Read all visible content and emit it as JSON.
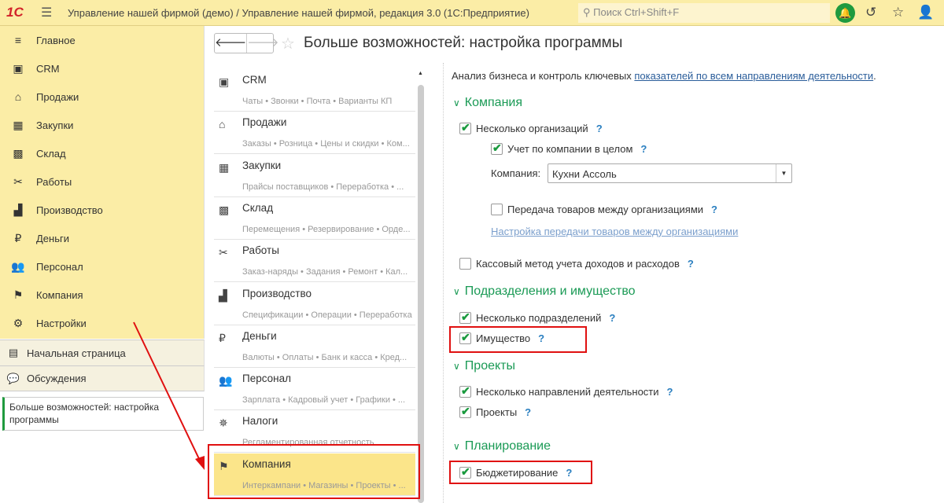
{
  "topbar": {
    "logo": "1С",
    "title": "Управление нашей фирмой (демо) / Управление нашей фирмой, редакция 3.0  (1С:Предприятие)",
    "search_placeholder": "Поиск Ctrl+Shift+F"
  },
  "sidebar": {
    "items": [
      {
        "label": "Главное",
        "icon": "≡"
      },
      {
        "label": "CRM",
        "icon": "▣"
      },
      {
        "label": "Продажи",
        "icon": "⌂"
      },
      {
        "label": "Закупки",
        "icon": "▦"
      },
      {
        "label": "Склад",
        "icon": "▩"
      },
      {
        "label": "Работы",
        "icon": "✂"
      },
      {
        "label": "Производство",
        "icon": "▟"
      },
      {
        "label": "Деньги",
        "icon": "₽"
      },
      {
        "label": "Персонал",
        "icon": "👥"
      },
      {
        "label": "Компания",
        "icon": "⚑"
      },
      {
        "label": "Настройки",
        "icon": "⚙"
      }
    ],
    "home": "Начальная страница",
    "discussions": "Обсуждения",
    "open_window": "Больше возможностей: настройка программы"
  },
  "page": {
    "title": "Больше возможностей: настройка программы"
  },
  "sections": [
    {
      "title": "CRM",
      "sub": "Чаты • Звонки • Почта • Варианты КП",
      "icon": "▣"
    },
    {
      "title": "Продажи",
      "sub": "Заказы • Розница • Цены и скидки • Ком...",
      "icon": "⌂"
    },
    {
      "title": "Закупки",
      "sub": "Прайсы поставщиков • Переработка • ...",
      "icon": "▦"
    },
    {
      "title": "Склад",
      "sub": "Перемещения • Резервирование • Орде...",
      "icon": "▩"
    },
    {
      "title": "Работы",
      "sub": "Заказ-наряды • Задания • Ремонт • Кал...",
      "icon": "✂"
    },
    {
      "title": "Производство",
      "sub": "Спецификации • Операции • Переработка",
      "icon": "▟"
    },
    {
      "title": "Деньги",
      "sub": "Валюты • Оплаты • Банк и касса • Кред...",
      "icon": "₽"
    },
    {
      "title": "Персонал",
      "sub": "Зарплата • Кадровый учет • Графики • ...",
      "icon": "👥"
    },
    {
      "title": "Налоги",
      "sub": "Регламентированная отчетность",
      "icon": "✵"
    },
    {
      "title": "Компания",
      "sub": "Интеркампани • Магазины • Проекты • ...",
      "icon": "⚑"
    }
  ],
  "content": {
    "intro": "Анализ бизнеса и контроль ключевых ",
    "intro_link": "показателей по всем направлениям деятельности",
    "h_company": "Компания",
    "multi_org": "Несколько организаций",
    "whole_company": "Учет по компании в целом",
    "company_label": "Компания:",
    "company_value": "Кухни Ассоль",
    "transfer": "Передача товаров между организациями",
    "transfer_link": "Настройка передачи товаров между организациями",
    "cash_method": "Кассовый метод учета доходов и расходов",
    "h_divisions": "Подразделения и имущество",
    "multi_div": "Несколько подразделений",
    "property": "Имущество",
    "h_projects": "Проекты",
    "multi_dir": "Несколько направлений деятельности",
    "projects": "Проекты",
    "h_planning": "Планирование",
    "budgeting": "Бюджетирование",
    "q": "?"
  },
  "colors": {
    "accent": "#1a9a55",
    "highlight": "#fbe58a",
    "annotation": "#e01010"
  }
}
